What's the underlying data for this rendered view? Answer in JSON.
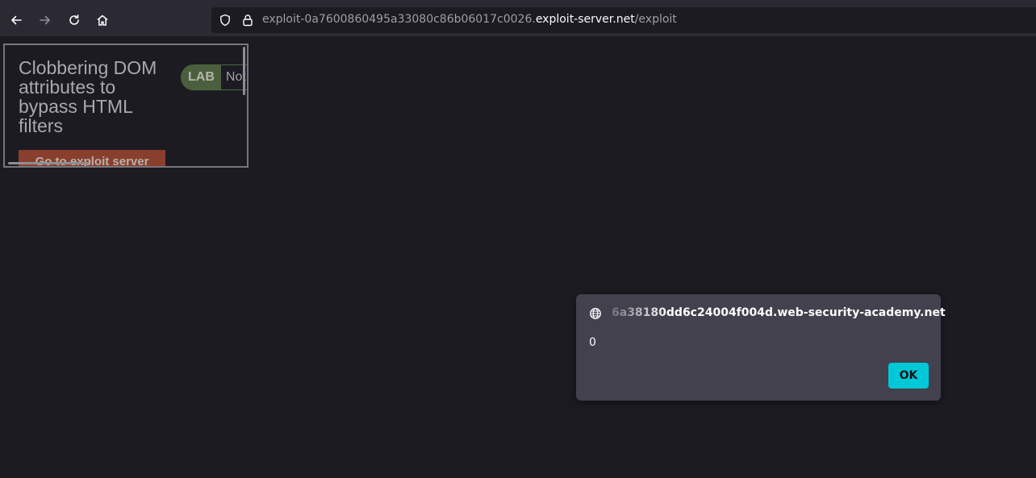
{
  "browser": {
    "nav": {
      "back_icon": "arrow-left-icon",
      "forward_icon": "arrow-right-icon",
      "reload_icon": "reload-icon",
      "home_icon": "home-icon"
    },
    "url": {
      "prefix": "exploit-0a7600860495a33080c86b06017c0026.",
      "host": "exploit-server.net",
      "path": "/exploit"
    }
  },
  "iframe": {
    "title": "Clobbering DOM attributes to bypass HTML filters",
    "badge_label": "LAB",
    "status": "Not solved",
    "exploit_button": "Go to exploit server"
  },
  "alert": {
    "origin": "6a38180dd6c24004f004d.web-security-academy.net",
    "message": "0",
    "ok_label": "OK"
  },
  "colors": {
    "background": "#1c1b22",
    "toolbar": "#2b2a33",
    "dialog": "#42414d",
    "accent": "#00c8d7"
  }
}
